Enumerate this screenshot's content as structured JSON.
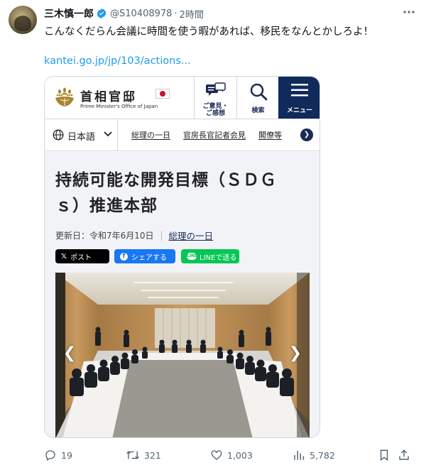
{
  "tweet": {
    "display_name": "三木慎一郎",
    "handle": "@S10408978",
    "separator": "·",
    "time": "2時間",
    "text": "こんなくだらん会議に時間を使う暇があれば、移民をなんとかしろよ！",
    "link": "kantei.go.jp/jp/103/actions...",
    "verified_color": "#1d9bf0"
  },
  "card": {
    "site": {
      "title": "首相官邸",
      "subtitle": "Prime Minister's Office of Japan",
      "opinion_label": "ご意見・ご感想",
      "search_label": "検索",
      "menu_label": "メニュー",
      "accent_color": "#0f2a5b"
    },
    "nav": {
      "language": "日本語",
      "links": [
        "総理の一日",
        "官房長官記者会見",
        "閣僚等"
      ]
    },
    "article": {
      "title": "持続可能な開発目標（ＳＤＧｓ）推進本部",
      "updated": "更新日：令和7年6月10日",
      "category": "総理の一日"
    },
    "share": {
      "x_label": "ポスト",
      "facebook_label": "シェアする",
      "line_label": "LINEで送る"
    }
  },
  "actions": {
    "replies": "19",
    "retweets": "321",
    "likes": "1,003",
    "views": "5,782"
  }
}
